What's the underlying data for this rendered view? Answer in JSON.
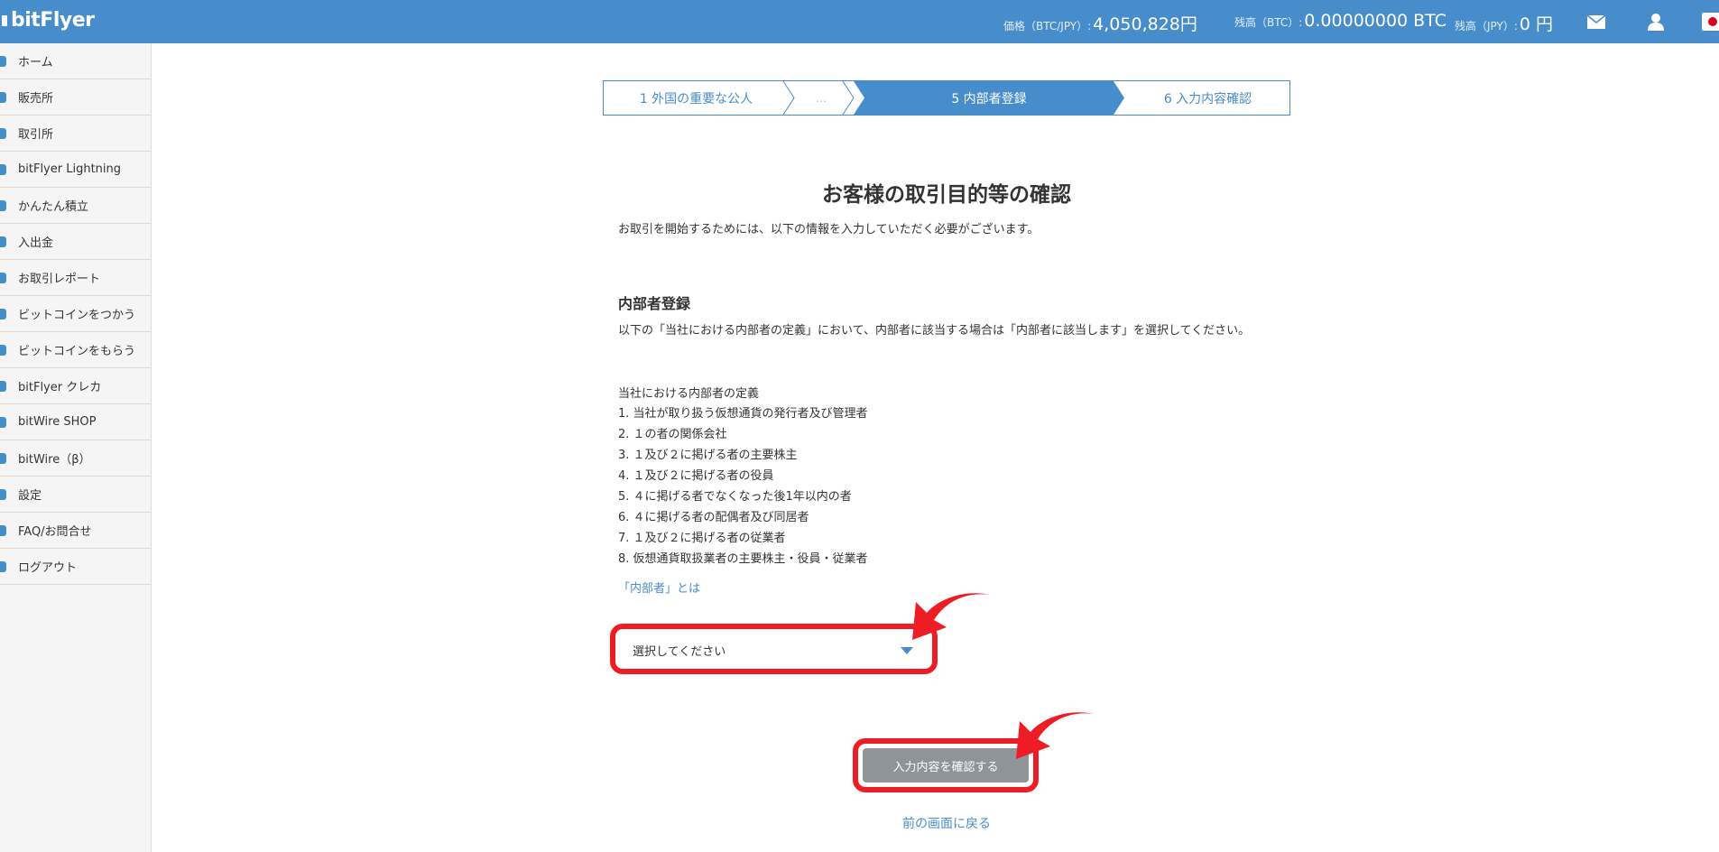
{
  "header": {
    "logo": "bitFlyer",
    "price_label": "価格（BTC/JPY）:",
    "price_value": "4,050,828円",
    "btc_label": "残高（BTC）:",
    "btc_value": "0.00000000 BTC",
    "jpy_label": "残高（JPY）:",
    "jpy_value": "0 円",
    "icons": [
      "mail-icon",
      "user-icon",
      "japan-flag-icon"
    ]
  },
  "sidebar": {
    "items": [
      {
        "label": "ホーム",
        "icon": "home-icon"
      },
      {
        "label": "販売所",
        "icon": "store-icon"
      },
      {
        "label": "取引所",
        "icon": "exchange-icon"
      },
      {
        "label": "bitFlyer Lightning",
        "icon": "lightning-icon"
      },
      {
        "label": "かんたん積立",
        "icon": "savings-icon"
      },
      {
        "label": "入出金",
        "icon": "deposit-icon"
      },
      {
        "label": "お取引レポート",
        "icon": "report-icon"
      },
      {
        "label": "ビットコインをつかう",
        "icon": "cart-icon"
      },
      {
        "label": "ビットコインをもらう",
        "icon": "gift-icon"
      },
      {
        "label": "bitFlyer クレカ",
        "icon": "card-icon"
      },
      {
        "label": "bitWire SHOP",
        "icon": "shop-icon"
      },
      {
        "label": "bitWire（β）",
        "icon": "share-icon"
      },
      {
        "label": "設定",
        "icon": "settings-icon"
      },
      {
        "label": "FAQ/お問合せ",
        "icon": "faq-icon"
      },
      {
        "label": "ログアウト",
        "icon": "logout-icon"
      }
    ]
  },
  "stepper": {
    "steps": [
      {
        "label": "1 外国の重要な公人",
        "active": false
      },
      {
        "label": "…",
        "active": false
      },
      {
        "label": "5 内部者登録",
        "active": true
      },
      {
        "label": "6 入力内容確認",
        "active": false
      }
    ],
    "active_color": "#478dcc"
  },
  "main": {
    "title": "お客様の取引目的等の確認",
    "intro": "お取引を開始するためには、以下の情報を入力していただく必要がございます。",
    "section_title": "内部者登録",
    "section_desc": "以下の「当社における内部者の定義」において、内部者に該当する場合は「内部者に該当します」を選択してください。",
    "definition_title": "当社における内部者の定義",
    "definitions": [
      "1.  当社が取り扱う仮想通貨の発行者及び管理者",
      "2.  １の者の関係会社",
      "3.  １及び２に掲げる者の主要株主",
      "4.  １及び２に掲げる者の役員",
      "5.  ４に掲げる者でなくなった後1年以内の者",
      "6.  ４に掲げる者の配偶者及び同居者",
      "7.  １及び２に掲げる者の従業者",
      "8.  仮想通貨取扱業者の主要株主・役員・従業者"
    ],
    "insider_link": "「内部者」とは",
    "select_placeholder": "選択してください",
    "confirm_button": "入力内容を確認する",
    "back_link": "前の画面に戻る"
  },
  "colors": {
    "brand": "#478dcc",
    "highlight": "#ee1c24",
    "button_disabled": "#8f9499"
  }
}
